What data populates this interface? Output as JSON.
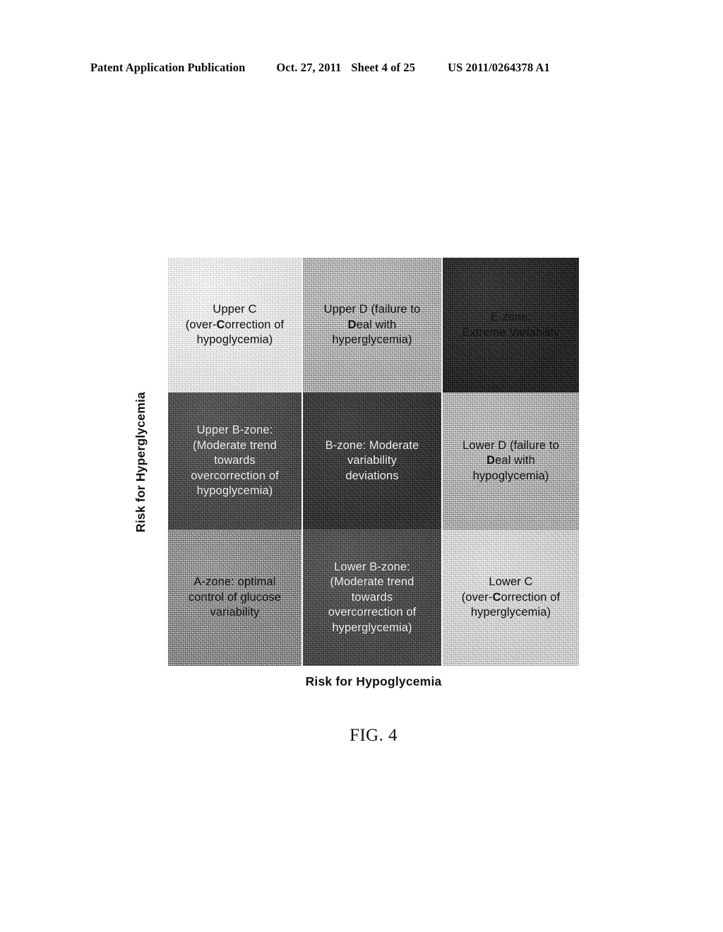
{
  "header": {
    "publication": "Patent Application Publication",
    "date": "Oct. 27, 2011",
    "sheet": "Sheet 4 of 25",
    "patent_number": "US 2011/0264378 A1"
  },
  "figure": {
    "caption": "FIG. 4",
    "y_axis_label": "Risk for Hyperglycemia",
    "x_axis_label": "Risk for Hypoglycemia"
  },
  "chart_data": {
    "type": "heatmap",
    "title": "FIG. 4",
    "xlabel": "Risk for Hypoglycemia",
    "ylabel": "Risk for Hyperglycemia",
    "grid": true,
    "legend": "none",
    "rows": 3,
    "cols": 3,
    "row_order_top_to_bottom": [
      "upper",
      "middle",
      "lower"
    ],
    "col_order_left_to_right": [
      "low",
      "moderate",
      "high"
    ],
    "cells": [
      {
        "row": 0,
        "col": 0,
        "id": "upper-c",
        "lines": [
          "Upper C",
          "(over-Correction of",
          "hypoglycemia)"
        ],
        "tone": "white",
        "tone_value": 0.97,
        "text_color": "#111111"
      },
      {
        "row": 0,
        "col": 1,
        "id": "upper-d",
        "lines": [
          "Upper D (failure to",
          "Deal with",
          "hyperglycemia)"
        ],
        "tone": "light",
        "tone_value": 0.7,
        "text_color": "#111111"
      },
      {
        "row": 0,
        "col": 2,
        "id": "e-zone",
        "lines": [
          "E-zone:",
          "Extreme Variability"
        ],
        "tone": "black",
        "tone_value": 0.1,
        "text_color": "#0c0c0c"
      },
      {
        "row": 1,
        "col": 0,
        "id": "upper-b-zone",
        "lines": [
          "Upper B-zone:",
          "(Moderate trend",
          "towards",
          "overcorrection of",
          "hypoglycemia)"
        ],
        "tone": "dark",
        "tone_value": 0.23,
        "text_color": "#f2f2f2"
      },
      {
        "row": 1,
        "col": 1,
        "id": "b-zone",
        "lines": [
          "B-zone: Moderate",
          "variability",
          "deviations"
        ],
        "tone": "vdark",
        "tone_value": 0.17,
        "text_color": "#f2f2f2"
      },
      {
        "row": 1,
        "col": 2,
        "id": "lower-d",
        "lines": [
          "Lower D (failure to",
          "Deal with",
          "hypoglycemia)"
        ],
        "tone": "light",
        "tone_value": 0.72,
        "text_color": "#111111"
      },
      {
        "row": 2,
        "col": 0,
        "id": "a-zone",
        "lines": [
          "A-zone: optimal",
          "control of glucose",
          "variability"
        ],
        "tone": "mid",
        "tone_value": 0.6,
        "text_color": "#111111"
      },
      {
        "row": 2,
        "col": 1,
        "id": "lower-b-zone",
        "lines": [
          "Lower B-zone:",
          "(Moderate trend",
          "towards",
          "overcorrection of",
          "hyperglycemia)"
        ],
        "tone": "dark",
        "tone_value": 0.21,
        "text_color": "#f2f2f2"
      },
      {
        "row": 2,
        "col": 2,
        "id": "lower-c",
        "lines": [
          "Lower C",
          "(over-Correction of",
          "hyperglycemia)"
        ],
        "tone": "vlight",
        "tone_value": 0.93,
        "text_color": "#111111"
      }
    ]
  }
}
